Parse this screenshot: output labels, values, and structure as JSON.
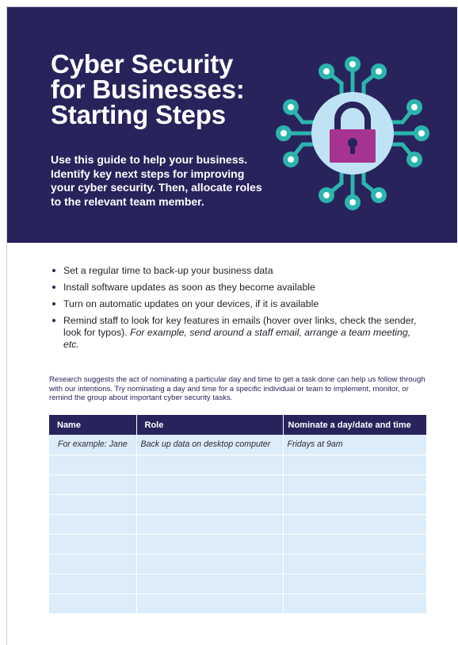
{
  "hero": {
    "title_lines": [
      "Cyber Security",
      "for Businesses:",
      "Starting Steps"
    ],
    "intro": "Use this guide to help your business. Identify key next steps for improving your cyber security. Then, allocate roles to the relevant team member.",
    "graphic_icon": "padlock-circuit-icon",
    "colors": {
      "background": "#29235c",
      "circuit": "#2bb5ad",
      "circle": "#bfe3f5",
      "lock": "#a6338f"
    }
  },
  "bullets": [
    {
      "text": "Set a regular time to back-up your business data"
    },
    {
      "text": "Install software updates as soon as they become available"
    },
    {
      "text": "Turn on automatic updates on your devices, if it is available"
    },
    {
      "text": "Remind staff to look for key features in emails (hover over links, check the sender, look for typos). ",
      "example": "For example, send around a staff email, arrange a team meeting, etc."
    }
  ],
  "research": "Research suggests the act of nominating a particular day and time to get a task done can help us follow through with our intentions. Try nominating a day and time for a specific individual or team to implement, monitor, or remind the group about important cyber security tasks.",
  "table": {
    "headers": [
      "Name",
      "Role",
      "Nominate a day/date and time"
    ],
    "rows": [
      [
        "For example: Jane",
        "Back up data on desktop computer",
        "Fridays at 9am"
      ],
      [
        "",
        "",
        ""
      ],
      [
        "",
        "",
        ""
      ],
      [
        "",
        "",
        ""
      ],
      [
        "",
        "",
        ""
      ],
      [
        "",
        "",
        ""
      ],
      [
        "",
        "",
        ""
      ],
      [
        "",
        "",
        ""
      ],
      [
        "",
        "",
        ""
      ]
    ]
  }
}
